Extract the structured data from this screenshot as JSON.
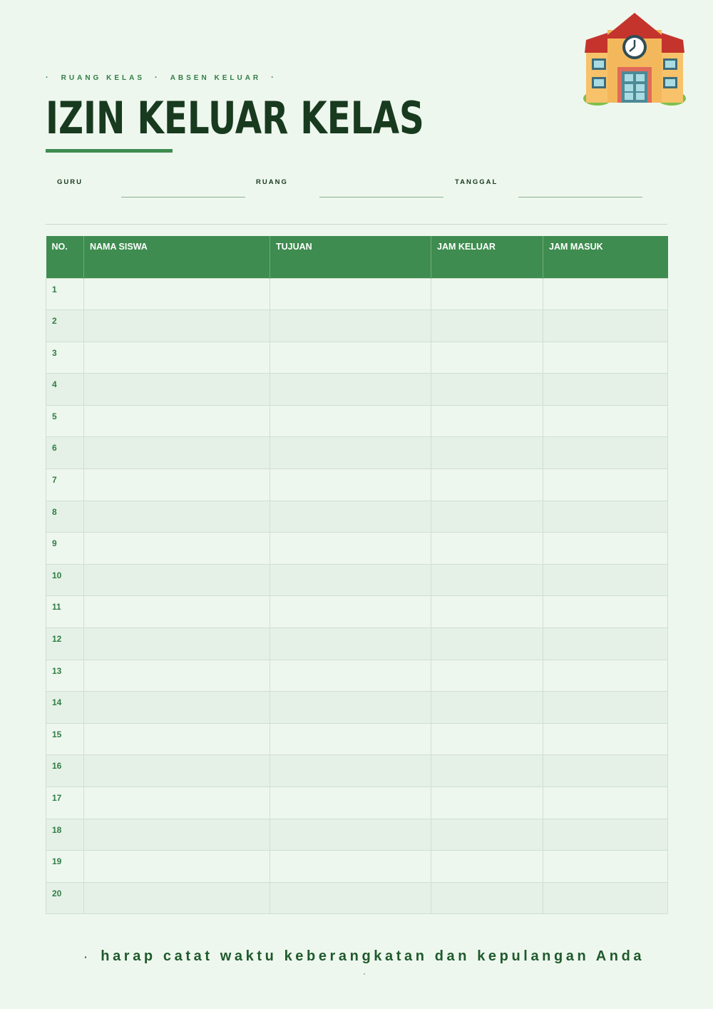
{
  "header": {
    "eyebrow_left": "RUANG KELAS",
    "eyebrow_right": "ABSEN KELUAR",
    "title": "IZIN KELUAR KELAS"
  },
  "fields": {
    "teacher_label": "GURU",
    "room_label": "RUANG",
    "date_label": "TANGGAL"
  },
  "table": {
    "columns": [
      "NO.",
      "NAMA SISWA",
      "TUJUAN",
      "JAM KELUAR",
      "JAM MASUK"
    ],
    "rows": [
      "1",
      "2",
      "3",
      "4",
      "5",
      "6",
      "7",
      "8",
      "9",
      "10",
      "11",
      "12",
      "13",
      "14",
      "15",
      "16",
      "17",
      "18",
      "19",
      "20"
    ]
  },
  "footer": {
    "note": "harap catat waktu keberangkatan dan kepulangan Anda"
  },
  "colors": {
    "background": "#eef7ee",
    "accent_green": "#3e8c4f",
    "title_dark_green": "#183a1f"
  },
  "icons": {
    "school_building": "school-building-icon"
  }
}
